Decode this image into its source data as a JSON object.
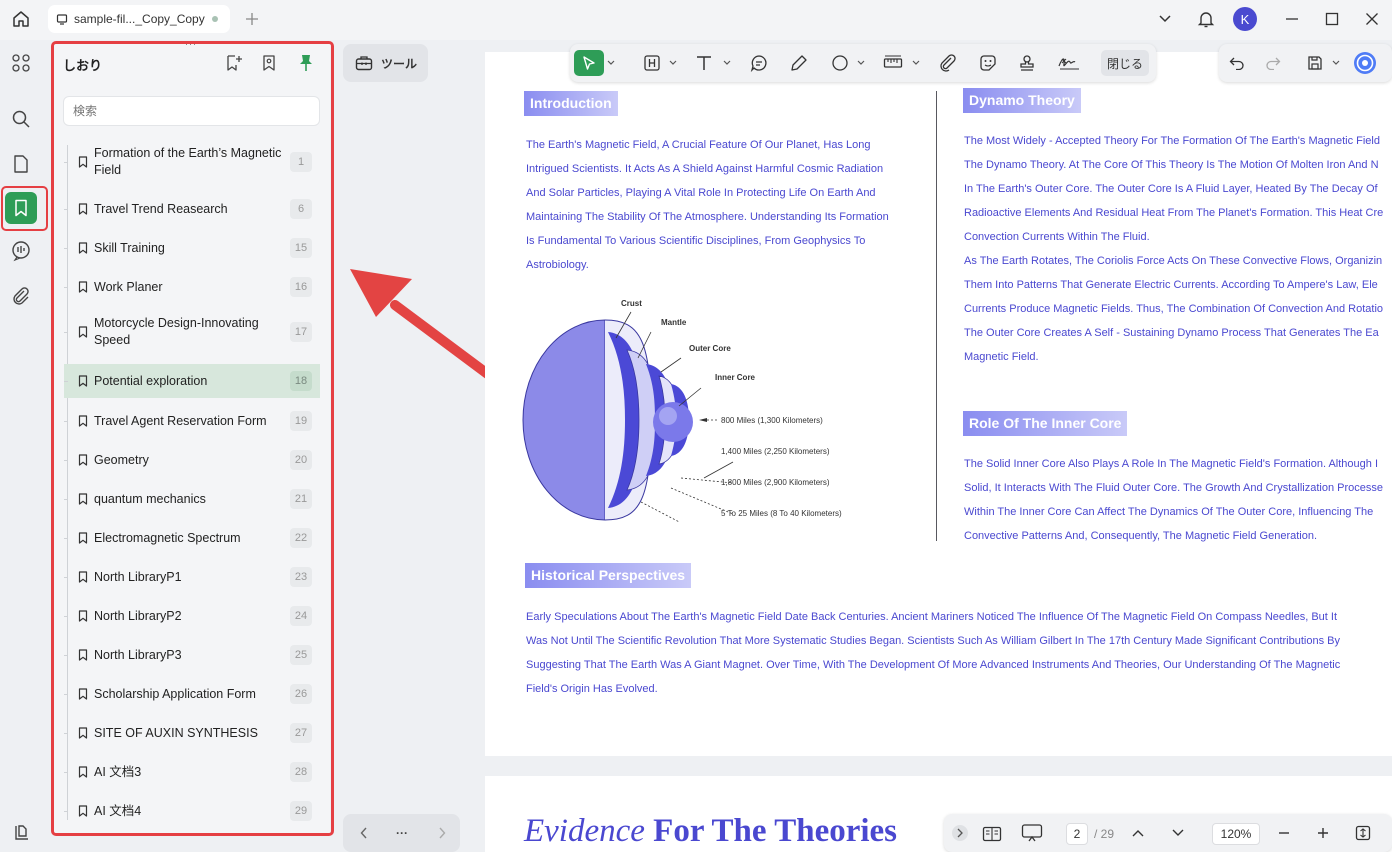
{
  "titlebar": {
    "tab_title": "sample-fil..._Copy_Copy",
    "avatar_letter": "K"
  },
  "icons": {
    "home": "home-icon",
    "apps": "grid-icon",
    "search": "search-icon",
    "pages": "pages-icon",
    "bookmarks": "bookmark-icon",
    "comments": "comment-icon",
    "attachments": "paperclip-icon",
    "layers": "layers-icon",
    "notifications": "bell-icon"
  },
  "bookmark_panel": {
    "title": "しおり",
    "search_placeholder": "検索",
    "items": [
      {
        "label": "Formation of the Earth’s Magnetic Field",
        "page": "1"
      },
      {
        "label": "Travel Trend Reasearch",
        "page": "6"
      },
      {
        "label": "Skill Training",
        "page": "15"
      },
      {
        "label": "Work Planer",
        "page": "16"
      },
      {
        "label": "Motorcycle Design-Innovating Speed",
        "page": "17"
      },
      {
        "label": "Potential exploration",
        "page": "18",
        "selected": true
      },
      {
        "label": "Travel Agent Reservation Form",
        "page": "19"
      },
      {
        "label": "Geometry",
        "page": "20"
      },
      {
        "label": "quantum mechanics",
        "page": "21"
      },
      {
        "label": "Electromagnetic Spectrum",
        "page": "22"
      },
      {
        "label": "North LibraryP1",
        "page": "23"
      },
      {
        "label": "North LibraryP2",
        "page": "24"
      },
      {
        "label": "North LibraryP3",
        "page": "25"
      },
      {
        "label": "Scholarship Application Form",
        "page": "26"
      },
      {
        "label": "SITE OF AUXIN SYNTHESIS",
        "page": "27"
      },
      {
        "label": "AI 文档3",
        "page": "28"
      },
      {
        "label": "AI 文档4",
        "page": "29"
      }
    ]
  },
  "tools_label": "ツール",
  "toolbar": {
    "close_label": "閉じる"
  },
  "nav_more": "···",
  "document": {
    "intro_heading": "Introduction",
    "intro_lines": [
      "The Earth's Magnetic Field, A Crucial Feature Of Our Planet, Has Long",
      "Intrigued Scientists. It Acts As A Shield Against Harmful Cosmic Radiation",
      "And Solar Particles, Playing A Vital Role In Protecting Life On Earth And",
      "Maintaining The Stability Of The Atmosphere. Understanding Its Formation",
      "Is Fundamental To Various Scientific Disciplines, From Geophysics To",
      "Astrobiology."
    ],
    "diagram": {
      "layers": [
        "Crust",
        "Mantle",
        "Outer Core",
        "Inner Core"
      ],
      "distances": [
        "800 Miles (1,300 Kilometers)",
        "1,400 Miles (2,250 Kilometers)",
        "1,800 Miles (2,900 Kilometers)",
        "5 To 25 Miles (8 To 40 Kilometers)"
      ]
    },
    "dynamo_heading": "Dynamo Theory",
    "dynamo_lines": [
      "The Most Widely - Accepted Theory For The Formation Of The Earth's Magnetic Field",
      "The Dynamo Theory. At The Core Of This Theory Is The Motion Of Molten Iron And N",
      "In The Earth's Outer Core. The Outer Core Is A Fluid Layer, Heated By The Decay Of",
      "Radioactive Elements And Residual Heat From The Planet's Formation. This Heat Cre",
      "Convection Currents Within The Fluid.",
      "As The Earth Rotates, The Coriolis Force Acts On These Convective Flows, Organizin",
      "Them Into Patterns That Generate Electric Currents. According To Ampere's Law, Ele",
      "Currents Produce Magnetic Fields. Thus, The Combination Of Convection And Rotatio",
      "The Outer Core Creates A Self - Sustaining Dynamo Process That Generates The Ea",
      "Magnetic Field."
    ],
    "inner_core_heading": "Role Of The Inner Core",
    "inner_core_lines": [
      "The Solid Inner Core Also Plays A Role In The Magnetic Field's Formation. Although I",
      "Solid, It Interacts With The Fluid Outer Core. The Growth And Crystallization Processe",
      "Within The Inner Core Can Affect The Dynamics Of The Outer Core, Influencing The",
      "Convective Patterns And, Consequently, The Magnetic Field Generation."
    ],
    "history_heading": "Historical Perspectives",
    "history_lines": [
      "Early Speculations About The Earth's Magnetic Field Date Back Centuries. Ancient Mariners Noticed The Influence Of The Magnetic Field On Compass Needles, But It",
      "Was Not Until The Scientific Revolution That More Systematic Studies Began. Scientists Such As William Gilbert In The 17th Century Made Significant Contributions By",
      "Suggesting That The Earth Was A Giant Magnet. Over Time, With The Development Of More Advanced Instruments And Theories, Our Understanding Of The Magnetic",
      "Field's Origin Has Evolved."
    ],
    "page2_title_italic": "Evidence",
    "page2_title_bold": " For The Theories"
  },
  "bottom_bar": {
    "current_page": "2",
    "total_pages": "/ 29",
    "zoom": "120%"
  },
  "colors": {
    "accent_green": "#2e9d57",
    "highlight_red": "#e53f43",
    "doc_text": "#4a48d0"
  }
}
